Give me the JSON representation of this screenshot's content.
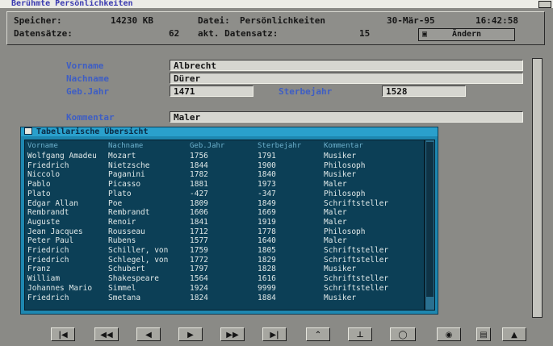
{
  "window": {
    "title": "Berühmte Persönlichkeiten"
  },
  "status": {
    "speicher_label": "Speicher:",
    "speicher_value": "14230 KB",
    "datei_label": "Datei:",
    "datei_value": "Persönlichkeiten",
    "date": "30-Mär-95",
    "time": "16:42:58",
    "datensaetze_label": "Datensätze:",
    "datensaetze_value": "62",
    "akt_label": "akt. Datensatz:",
    "akt_value": "15",
    "aendern_label": "Ändern"
  },
  "form": {
    "vorname_label": "Vorname",
    "vorname_value": "Albrecht",
    "nachname_label": "Nachname",
    "nachname_value": "Dürer",
    "geb_label": "Geb.Jahr",
    "geb_value": "1471",
    "sterbe_label": "Sterbejahr",
    "sterbe_value": "1528",
    "kommentar_label": "Kommentar",
    "kommentar_value": "Maler"
  },
  "table": {
    "title": "Tabellarische Übersicht",
    "columns": [
      "Vorname",
      "Nachname",
      "Geb.Jahr",
      "Sterbejahr",
      "Kommentar"
    ],
    "rows": [
      [
        "Wolfgang Amadeu",
        "Mozart",
        "1756",
        "1791",
        "Musiker"
      ],
      [
        "Friedrich",
        "Nietzsche",
        "1844",
        "1900",
        "Philosoph"
      ],
      [
        "Niccolo",
        "Paganini",
        "1782",
        "1840",
        "Musiker"
      ],
      [
        "Pablo",
        "Picasso",
        "1881",
        "1973",
        "Maler"
      ],
      [
        "Plato",
        "Plato",
        "-427",
        "-347",
        "Philosoph"
      ],
      [
        "Edgar Allan",
        "Poe",
        "1809",
        "1849",
        "Schriftsteller"
      ],
      [
        "Rembrandt",
        "Rembrandt",
        "1606",
        "1669",
        "Maler"
      ],
      [
        "Auguste",
        "Renoir",
        "1841",
        "1919",
        "Maler"
      ],
      [
        "Jean Jacques",
        "Rousseau",
        "1712",
        "1778",
        "Philosoph"
      ],
      [
        "Peter Paul",
        "Rubens",
        "1577",
        "1640",
        "Maler"
      ],
      [
        "Friedrich",
        "Schiller, von",
        "1759",
        "1805",
        "Schriftsteller"
      ],
      [
        "Friedrich",
        "Schlegel, von",
        "1772",
        "1829",
        "Schriftsteller"
      ],
      [
        "Franz",
        "Schubert",
        "1797",
        "1828",
        "Musiker"
      ],
      [
        "William",
        "Shakespeare",
        "1564",
        "1616",
        "Schriftsteller"
      ],
      [
        "Johannes Mario",
        "Simmel",
        "1924",
        "9999",
        "Schriftsteller"
      ],
      [
        "Friedrich",
        "Smetana",
        "1824",
        "1884",
        "Musiker"
      ]
    ]
  },
  "toolbar": {
    "buttons": [
      {
        "icon": "first-record-icon",
        "glyph": "|◀"
      },
      {
        "icon": "rewind-icon",
        "glyph": "◀◀"
      },
      {
        "icon": "previous-record-icon",
        "glyph": "◀"
      },
      {
        "icon": "next-record-icon",
        "glyph": "▶"
      },
      {
        "icon": "fast-forward-icon",
        "glyph": "▶▶"
      },
      {
        "icon": "last-record-icon",
        "glyph": "▶|"
      },
      {
        "icon": "insert-record-icon",
        "glyph": "⌃"
      },
      {
        "icon": "delete-record-icon",
        "glyph": "⊥"
      },
      {
        "icon": "search-oval-icon",
        "glyph": "◯"
      },
      {
        "icon": "view-eye-icon",
        "glyph": "◉"
      },
      {
        "icon": "print-icon",
        "glyph": "▤"
      },
      {
        "icon": "up-arrow-icon",
        "glyph": "▲"
      }
    ]
  }
}
